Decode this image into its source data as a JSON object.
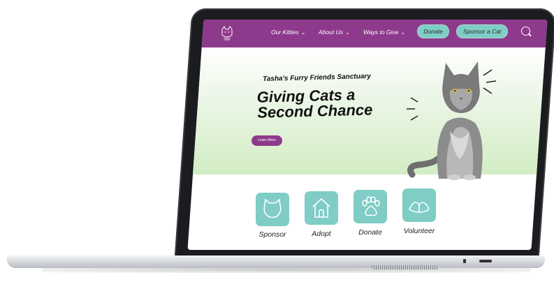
{
  "site": {
    "logo_icon": "cat-logo-icon",
    "nav": {
      "items": [
        {
          "label": "Our Kitties",
          "icon": "chevron-down-icon"
        },
        {
          "label": "About Us",
          "icon": "chevron-down-icon"
        },
        {
          "label": "Ways to Give",
          "icon": "chevron-down-icon"
        }
      ],
      "donate_label": "Donate",
      "sponsor_label": "Sponsor a Cat",
      "search_icon": "search-icon"
    },
    "hero": {
      "subtitle": "Tasha's Furry Friends Sanctuary",
      "title": "Giving Cats a Second Chance",
      "button_label": "Learn More",
      "image": "maine-coon-cat-photo"
    },
    "actions": [
      {
        "label": "Sponsor",
        "icon": "cat-face-icon"
      },
      {
        "label": "Adopt",
        "icon": "house-icon"
      },
      {
        "label": "Donate",
        "icon": "paw-print-icon"
      },
      {
        "label": "Volunteer",
        "icon": "heart-hands-icon"
      }
    ]
  },
  "colors": {
    "nav_purple": "#8e3a8c",
    "accent_teal": "#7fcdc5",
    "hero_green": "#d2edc4",
    "laptop_frame": "#1b1c20"
  }
}
